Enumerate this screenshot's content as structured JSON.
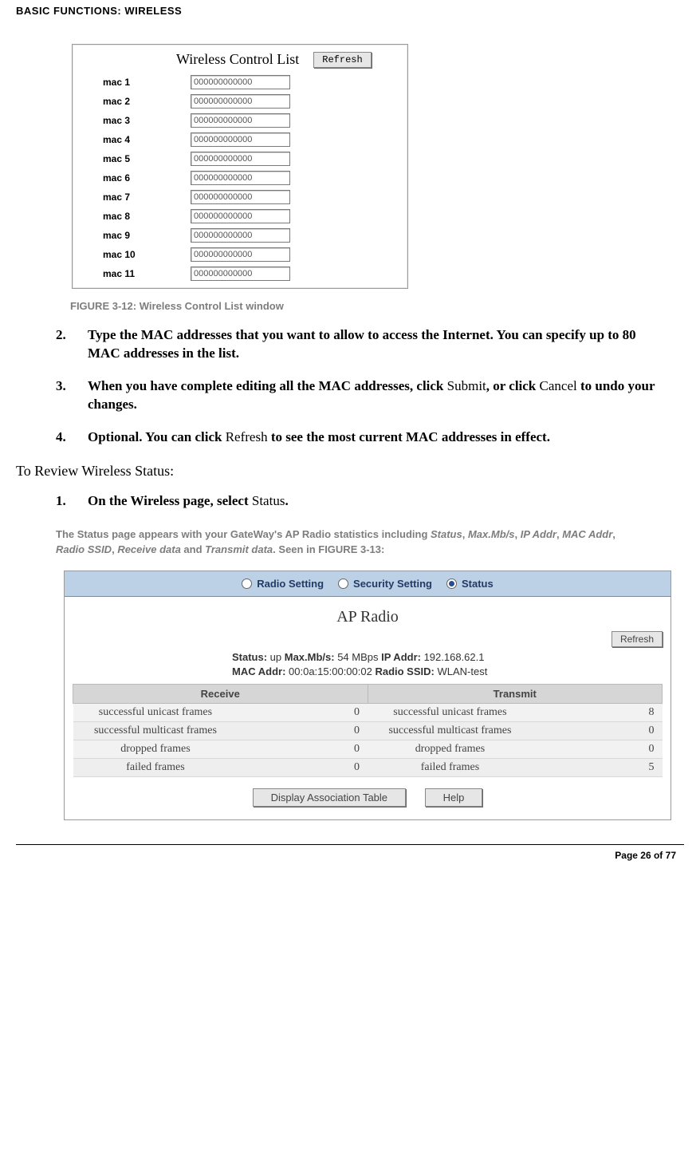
{
  "header": "BASIC FUNCTIONS: WIRELESS",
  "fig1": {
    "title": "Wireless Control List",
    "refresh": "Refresh",
    "rows": [
      {
        "label": "mac 1",
        "value": "000000000000"
      },
      {
        "label": "mac 2",
        "value": "000000000000"
      },
      {
        "label": "mac 3",
        "value": "000000000000"
      },
      {
        "label": "mac 4",
        "value": "000000000000"
      },
      {
        "label": "mac 5",
        "value": "000000000000"
      },
      {
        "label": "mac 6",
        "value": "000000000000"
      },
      {
        "label": "mac 7",
        "value": "000000000000"
      },
      {
        "label": "mac 8",
        "value": "000000000000"
      },
      {
        "label": "mac 9",
        "value": "000000000000"
      },
      {
        "label": "mac 10",
        "value": "000000000000"
      },
      {
        "label": "mac 11",
        "value": "000000000000"
      }
    ]
  },
  "caption1": {
    "pre": "FIGURE 3-12: ",
    "title": "Wireless Control List window"
  },
  "steps_a": {
    "s2": {
      "num": "2.",
      "bold": "Type the MAC addresses that you want to allow to access the Internet. You can specify up to 80 MAC addresses in the list."
    },
    "s3": {
      "num": "3.",
      "b1": "When you have complete editing all the MAC addresses, click ",
      "n1": "Submit",
      "b2": ", or click ",
      "n2": "Cancel",
      "b3": " to undo your changes."
    },
    "s4": {
      "num": "4.",
      "b1": "Optional. You can click ",
      "n1": "Refresh",
      "b2": " to see the most current MAC addresses in effect."
    }
  },
  "section_head": "To Review Wireless Status:",
  "steps_b": {
    "s1": {
      "num": "1.",
      "b1": "On the Wireless page, select ",
      "n1": "Status",
      "b2": "."
    }
  },
  "status_desc": {
    "t1": "The Status page appears with your GateWay's AP Radio statistics including ",
    "i1": "Status",
    "c": ", ",
    "i2": "Max.Mb/s",
    "i3": "IP Addr",
    "i4": "MAC Addr",
    "i5": "Radio SSID",
    "i6": "Receive data",
    "and": " and ",
    "i7": "Transmit data",
    "t2": ". Seen in ",
    "figref": "FIGURE 3-13",
    "t3": ":"
  },
  "fig2": {
    "tabs": {
      "radio_setting": "Radio Setting",
      "security_setting": "Security Setting",
      "status": "Status"
    },
    "ap_title": "AP Radio",
    "refresh": "Refresh",
    "info": {
      "l1a": "Status:",
      "l1av": " up  ",
      "l1b": "Max.Mb/s:",
      "l1bv": " 54 MBps  ",
      "l1c": "IP Addr:",
      "l1cv": " 192.168.62.1",
      "l2a": "MAC Addr:",
      "l2av": " 00:0a:15:00:00:02  ",
      "l2b": "Radio SSID:",
      "l2bv": " WLAN-test"
    },
    "thead": {
      "recv": "Receive",
      "trans": "Transmit"
    },
    "rows": [
      {
        "rl": "successful unicast frames",
        "rv": "0",
        "tl": "successful unicast frames",
        "tv": "8"
      },
      {
        "rl": "successful multicast frames",
        "rv": "0",
        "tl": "successful multicast frames",
        "tv": "0"
      },
      {
        "rl": "dropped frames",
        "rv": "0",
        "tl": "dropped frames",
        "tv": "0"
      },
      {
        "rl": "failed frames",
        "rv": "0",
        "tl": "failed frames",
        "tv": "5"
      }
    ],
    "btn_display": "Display Association Table",
    "btn_help": "Help"
  },
  "footer": "Page 26 of 77"
}
